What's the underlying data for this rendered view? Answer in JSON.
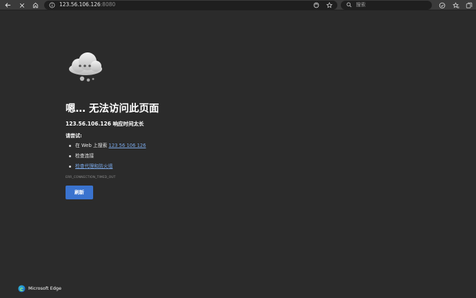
{
  "toolbar": {
    "url_host": "123.56.106.126",
    "url_port": ":8080",
    "search_placeholder": "搜索",
    "icons": [
      "back-arrow-icon",
      "close-icon",
      "home-icon",
      "info-icon",
      "tracking-prevention-icon",
      "favorite-star-icon",
      "search-icon",
      "copilot-icon",
      "favorites-icon",
      "collections-icon"
    ]
  },
  "error_page": {
    "title": "嗯… 无法访问此页面",
    "subtitle": "123.56.106.126 响应时间太长",
    "try_label": "请尝试:",
    "suggestions": {
      "search_prefix": "在 Web 上搜索 ",
      "search_link": "123 56 106 126",
      "check_connection": "检查连接",
      "check_proxy_link": "检查代理和防火墙"
    },
    "error_code": "ERR_CONNECTION_TIMED_OUT",
    "refresh_label": "刷新"
  },
  "brand": {
    "name": "Microsoft Edge"
  }
}
